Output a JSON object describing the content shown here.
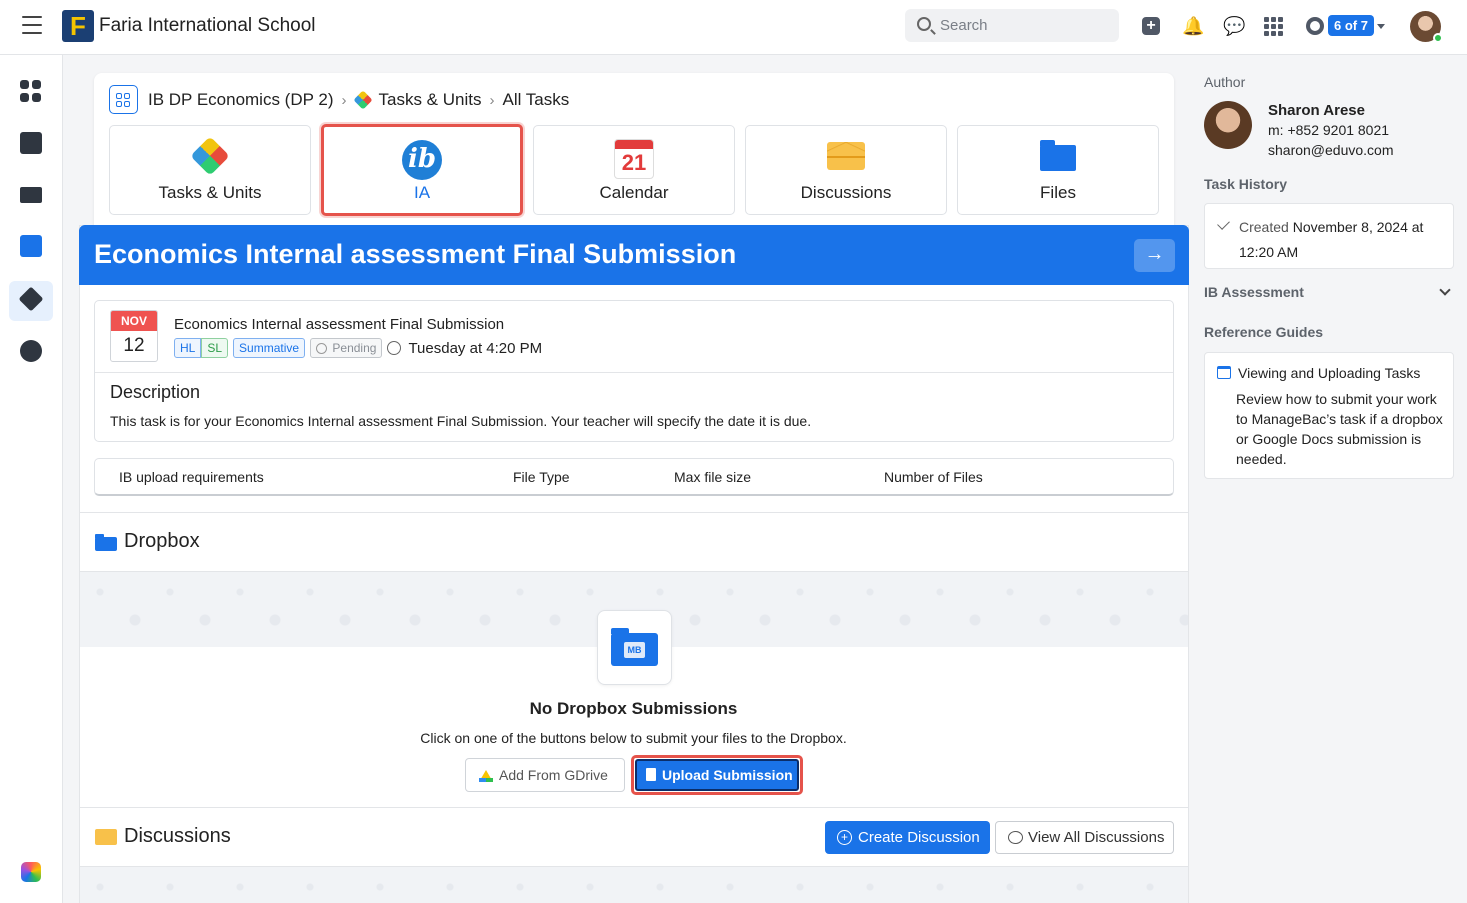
{
  "topbar": {
    "school_name": "Faria International School",
    "logo_letter": "F",
    "search_placeholder": "Search",
    "badge_count": "6 of 7"
  },
  "breadcrumb": {
    "course": "IB DP Economics (DP 2)",
    "section": "Tasks & Units",
    "page": "All Tasks"
  },
  "tabs": [
    {
      "label": "Tasks & Units",
      "icon": "puzzle-icon"
    },
    {
      "label": "IA",
      "icon": "ib-logo-icon",
      "active": true
    },
    {
      "label": "Calendar",
      "icon": "calendar-icon",
      "icon_text": "21"
    },
    {
      "label": "Discussions",
      "icon": "envelope-icon"
    },
    {
      "label": "Files",
      "icon": "folder-icon"
    }
  ],
  "task": {
    "header_title": "Economics Internal assessment Final Submission",
    "date_month": "NOV",
    "date_day": "12",
    "title": "Economics Internal assessment Final Submission",
    "tags": {
      "hl": "HL",
      "sl": "SL",
      "type": "Summative",
      "status": "Pending"
    },
    "due": "Tuesday at 4:20 PM",
    "description_heading": "Description",
    "description": "This task is for your Economics Internal assessment Final Submission. Your teacher will specify the date it is due."
  },
  "requirements": {
    "col1": "IB upload requirements",
    "col2": "File Type",
    "col3": "Max file size",
    "col4": "Number of Files"
  },
  "dropbox": {
    "heading": "Dropbox",
    "tile_label": "MB",
    "empty_title": "No Dropbox Submissions",
    "empty_text": "Click on one of the buttons below to submit your files to the Dropbox.",
    "gdrive_button": "Add From GDrive",
    "upload_button": "Upload Submission"
  },
  "discussions": {
    "heading": "Discussions",
    "create_button": "Create Discussion",
    "view_all_button": "View All Discussions"
  },
  "right_panel": {
    "author_heading": "Author",
    "author_name": "Sharon Arese",
    "author_phone": "m: +852 9201 8021",
    "author_email": "sharon@eduvo.com",
    "history_heading": "Task History",
    "history_created_label": "Created",
    "history_created_date": "November 8, 2024 at 12:20 AM",
    "ib_assessment": "IB Assessment",
    "reference_heading": "Reference Guides",
    "guide_title": "Viewing and Uploading Tasks",
    "guide_desc": "Review how to submit your work to ManageBac’s task if a dropbox or Google Docs submission is needed."
  },
  "colors": {
    "accent": "#1a73e8",
    "highlight": "#e5534b",
    "date_red": "#ef5350"
  }
}
